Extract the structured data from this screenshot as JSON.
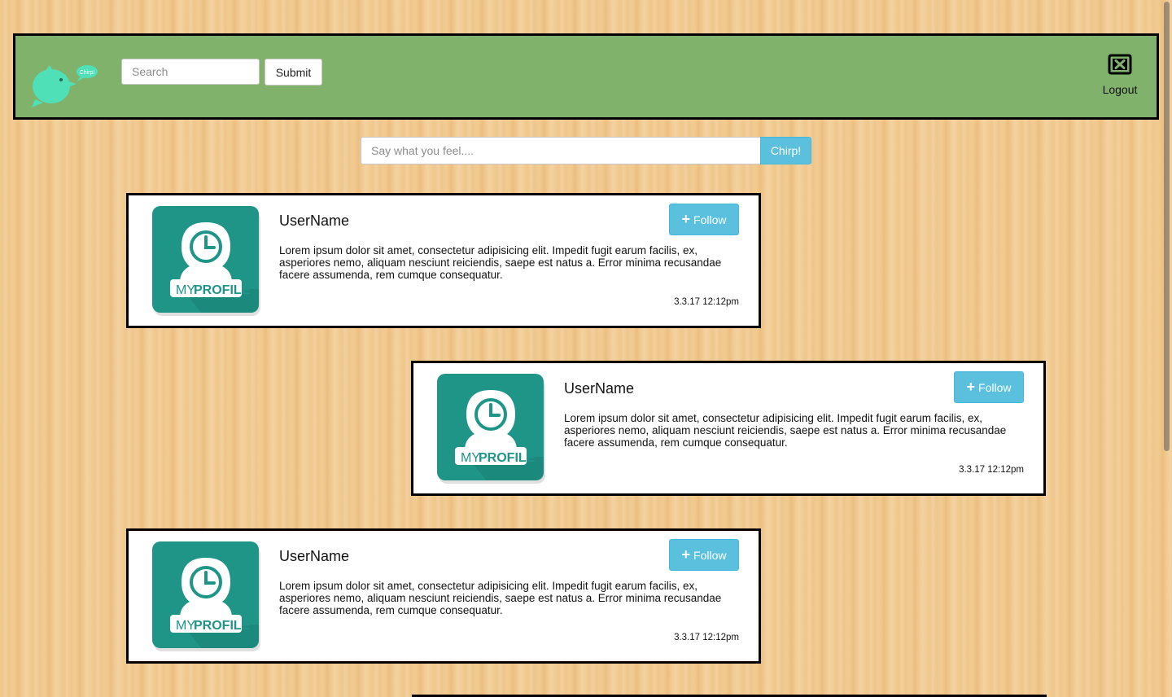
{
  "header": {
    "logo_bubble_text": "Chirp!",
    "search": {
      "placeholder": "Search",
      "value": ""
    },
    "submit_label": "Submit",
    "logout_label": "Logout"
  },
  "compose": {
    "placeholder": "Say what you feel....",
    "value": "",
    "chirp_label": "Chirp!"
  },
  "colors": {
    "header_bg": "#80b26c",
    "accent_blue": "#5bc0de",
    "avatar_teal": "#1f9588",
    "logo_bird": "#4fe0b8"
  },
  "posts": [
    {
      "username": "UserName",
      "follow_label": "Follow",
      "body": "Lorem ipsum dolor sit amet, consectetur adipisicing elit. Impedit fugit earum facilis, ex, asperiores nemo, aliquam nesciunt reiciendis, saepe est natus a. Error minima recusandae facere assumenda, rem cumque consequatur.",
      "timestamp": "3.3.17 12:12pm",
      "avatar": {
        "text_light": "MY",
        "text_bold": "PROFILE",
        "icon": "profile-clock-icon"
      }
    },
    {
      "username": "UserName",
      "follow_label": "Follow",
      "body": "Lorem ipsum dolor sit amet, consectetur adipisicing elit. Impedit fugit earum facilis, ex, asperiores nemo, aliquam nesciunt reiciendis, saepe est natus a. Error minima recusandae facere assumenda, rem cumque consequatur.",
      "timestamp": "3.3.17 12:12pm",
      "avatar": {
        "text_light": "MY",
        "text_bold": "PROFILE",
        "icon": "profile-clock-icon"
      }
    },
    {
      "username": "UserName",
      "follow_label": "Follow",
      "body": "Lorem ipsum dolor sit amet, consectetur adipisicing elit. Impedit fugit earum facilis, ex, asperiores nemo, aliquam nesciunt reiciendis, saepe est natus a. Error minima recusandae facere assumenda, rem cumque consequatur.",
      "timestamp": "3.3.17 12:12pm",
      "avatar": {
        "text_light": "MY",
        "text_bold": "PROFILE",
        "icon": "profile-clock-icon"
      }
    }
  ]
}
